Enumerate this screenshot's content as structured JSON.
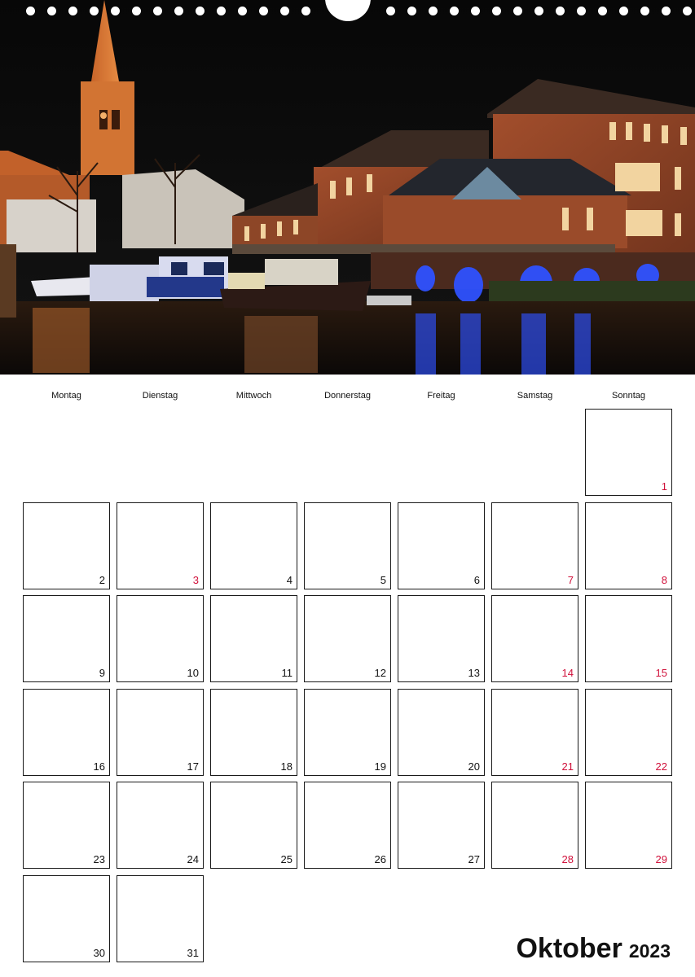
{
  "calendar": {
    "month": "Oktober",
    "year": "2023",
    "weekdays": [
      "Montag",
      "Dienstag",
      "Mittwoch",
      "Donnerstag",
      "Freitag",
      "Samstag",
      "Sonntag"
    ],
    "first_weekday_index": 6,
    "days": [
      "1",
      "2",
      "3",
      "4",
      "5",
      "6",
      "7",
      "8",
      "9",
      "10",
      "11",
      "12",
      "13",
      "14",
      "15",
      "16",
      "17",
      "18",
      "19",
      "20",
      "21",
      "22",
      "23",
      "24",
      "25",
      "26",
      "27",
      "28",
      "29",
      "30",
      "31"
    ],
    "highlighted_days": [
      "1",
      "3",
      "7",
      "8",
      "14",
      "15",
      "21",
      "22",
      "28",
      "29"
    ]
  },
  "colors": {
    "highlight": "#d0103a",
    "text": "#111111",
    "border": "#1a1a1a"
  }
}
